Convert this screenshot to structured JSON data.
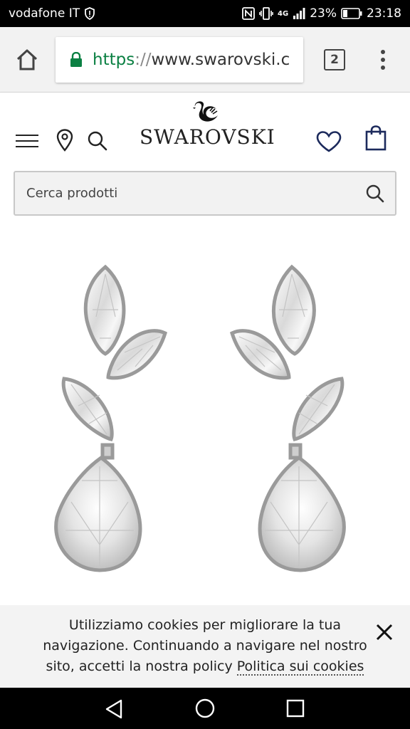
{
  "status_bar": {
    "carrier": "vodafone IT",
    "network": "4G",
    "battery": "23%",
    "time": "23:18"
  },
  "browser": {
    "url_scheme": "https",
    "url_sep": "://",
    "url_host": "www.swarovski.c",
    "tab_count": "2"
  },
  "site": {
    "brand": "SWAROVSKI",
    "search_placeholder": "Cerca prodotti"
  },
  "cookie": {
    "text": "Utilizziamo cookies per migliorare la tua navigazione. Continuando a navigare nel nostro sito, accetti la nostra policy",
    "link_label": "Politica sui cookies"
  },
  "colors": {
    "accent_green": "#0b8043",
    "brand_navy": "#1c2a5c"
  }
}
